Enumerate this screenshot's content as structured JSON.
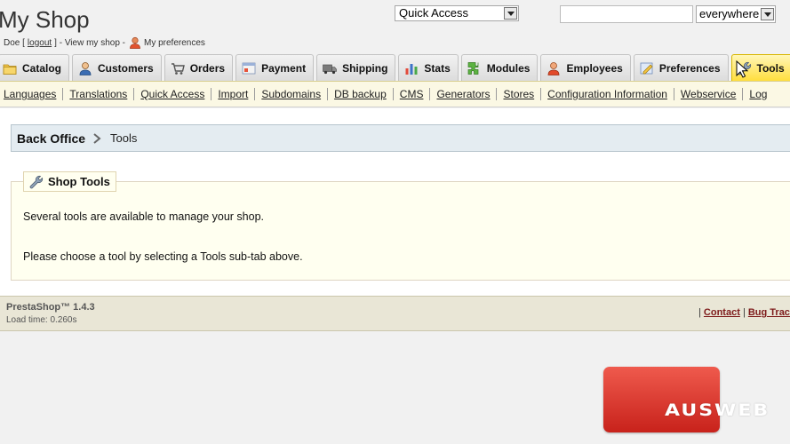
{
  "header": {
    "shop_title": "My Shop",
    "user_prefix": "Doe [",
    "logout_label": "logout",
    "user_suffix": "] - View my shop -",
    "preferences_label": "My preferences"
  },
  "quick_access": {
    "selected": "Quick Access"
  },
  "search": {
    "value": "",
    "placeholder": ""
  },
  "search_scope": {
    "selected": "everywhere"
  },
  "tabs": [
    {
      "label": "Catalog",
      "icon": "catalog-icon"
    },
    {
      "label": "Customers",
      "icon": "customers-icon"
    },
    {
      "label": "Orders",
      "icon": "orders-icon"
    },
    {
      "label": "Payment",
      "icon": "payment-icon"
    },
    {
      "label": "Shipping",
      "icon": "shipping-icon"
    },
    {
      "label": "Stats",
      "icon": "stats-icon"
    },
    {
      "label": "Modules",
      "icon": "modules-icon"
    },
    {
      "label": "Employees",
      "icon": "employees-icon"
    },
    {
      "label": "Preferences",
      "icon": "preferences-icon"
    },
    {
      "label": "Tools",
      "icon": "wrench-icon",
      "active": true
    }
  ],
  "subtabs": [
    "Languages",
    "Translations",
    "Quick Access",
    "Import",
    "Subdomains",
    "DB backup",
    "CMS",
    "Generators",
    "Stores",
    "Configuration Information",
    "Webservice",
    "Log"
  ],
  "breadcrumb": {
    "root": "Back Office",
    "current": "Tools"
  },
  "shop_tools": {
    "legend": "Shop Tools",
    "description_1": "Several tools are available to manage your shop.",
    "description_2": "Please choose a tool by selecting a Tools sub-tab above."
  },
  "footer": {
    "version": "PrestaShop™ 1.4.3",
    "load_time": "Load time: 0.260s",
    "separator": "|",
    "contact_label": "Contact",
    "separator_2": "|",
    "bug_tracker_label": "Bug Track"
  },
  "watermark": {
    "text": "AUSWEB"
  },
  "colors": {
    "active_tab": "#ffde3e",
    "subtab_bar": "#fbf8e4",
    "breadcrumb_bg": "#e4ecf1",
    "footer_link": "#7d1a1a",
    "logo_red": "#d9302a"
  }
}
